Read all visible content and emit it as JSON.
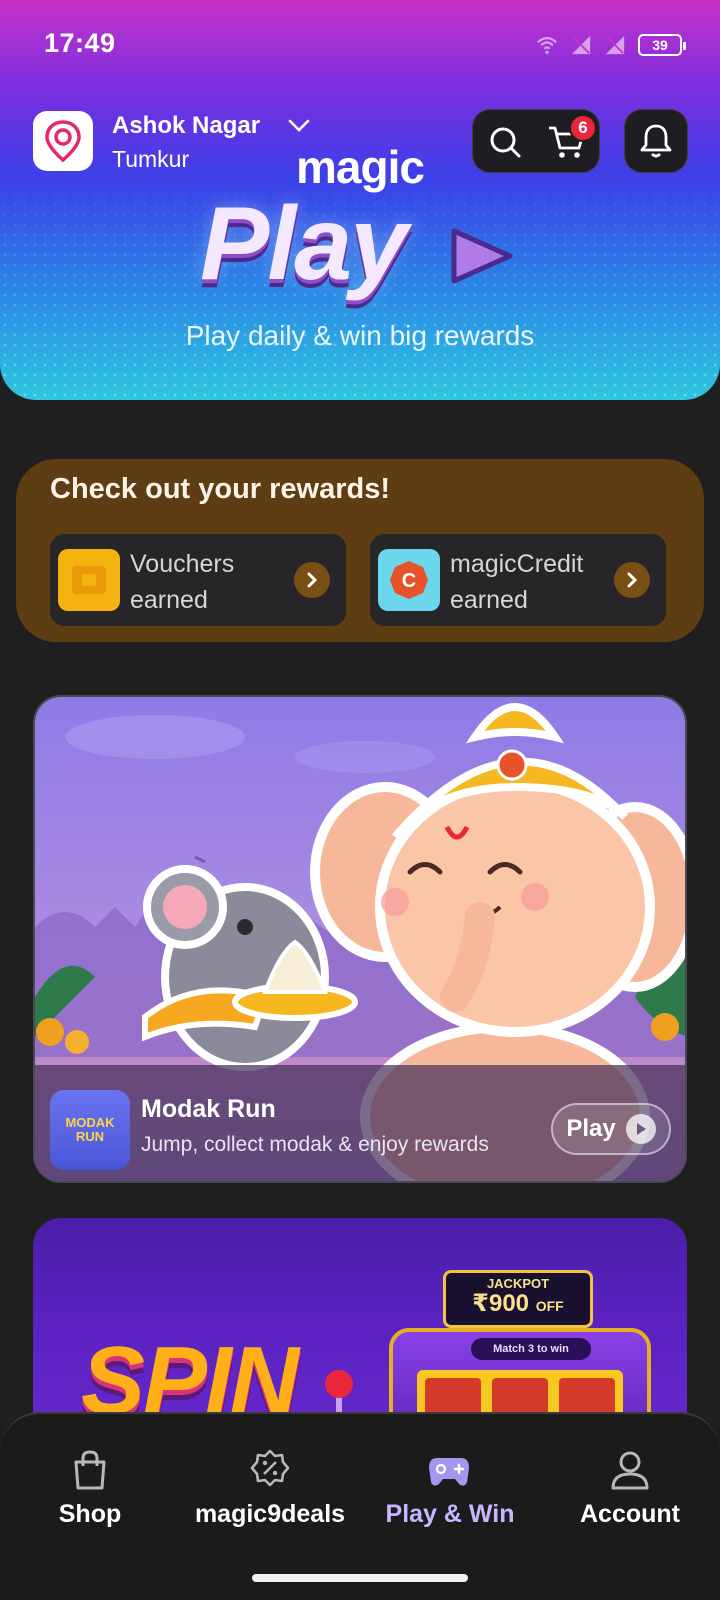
{
  "status": {
    "time": "17:49",
    "battery": "39"
  },
  "location": {
    "name": "Ashok Nagar",
    "city": "Tumkur"
  },
  "header": {
    "cart_count": "6"
  },
  "brand": {
    "magic": "magic",
    "play": "Play",
    "tagline": "Play daily & win big rewards"
  },
  "rewards": {
    "title": "Check out your rewards!",
    "cards": [
      {
        "label": "Vouchers earned",
        "icon": "voucher-icon"
      },
      {
        "label": "magicCredit earned",
        "icon": "magic-credit-icon"
      }
    ]
  },
  "games": [
    {
      "title": "Modak Run",
      "description": "Jump, collect modak & enjoy rewards",
      "button": "Play",
      "thumb_text": "MODAK RUN"
    }
  ],
  "spin": {
    "title": "SPIN",
    "jackpot_top": "JACKPOT",
    "jackpot_amount": "₹900",
    "jackpot_suffix": "OFF",
    "match_label": "Match 3 to win"
  },
  "nav": [
    {
      "label": "Shop",
      "icon": "shopping-bag-icon"
    },
    {
      "label": "magic9deals",
      "icon": "discount-badge-icon"
    },
    {
      "label": "Play & Win",
      "icon": "gamepad-icon",
      "active": true
    },
    {
      "label": "Account",
      "icon": "user-icon"
    }
  ],
  "colors": {
    "accent": "#c7b6ff",
    "rewards_bg": "#5e3d14",
    "badge": "#e8263c"
  }
}
